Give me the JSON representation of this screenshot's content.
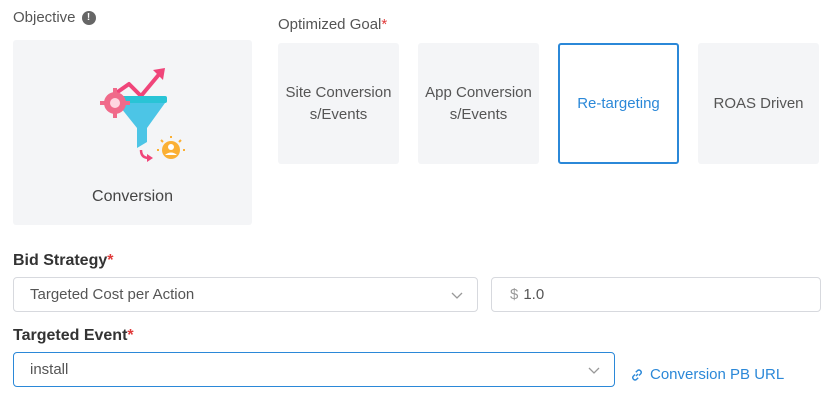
{
  "objective": {
    "label": "Objective",
    "info_icon": "!",
    "card": {
      "name": "Conversion",
      "icon": "conversion-funnel-icon"
    }
  },
  "optimized_goal": {
    "label": "Optimized Goal",
    "required_mark": "*",
    "options": [
      {
        "label": "Site Conversions/Events",
        "selected": false
      },
      {
        "label": "App Conversions/Events",
        "selected": false
      },
      {
        "label": "Re-targeting",
        "selected": true
      },
      {
        "label": "ROAS Driven",
        "selected": false
      }
    ]
  },
  "bid_strategy": {
    "label": "Bid Strategy",
    "required_mark": "*",
    "selected": "Targeted Cost per Action",
    "currency": "$",
    "amount": "1.0"
  },
  "targeted_event": {
    "label": "Targeted Event",
    "required_mark": "*",
    "selected": "install",
    "link_label": "Conversion PB URL"
  },
  "colors": {
    "accent": "#2b88d8",
    "required": "#e03a3a",
    "card_bg": "#f4f5f7"
  }
}
